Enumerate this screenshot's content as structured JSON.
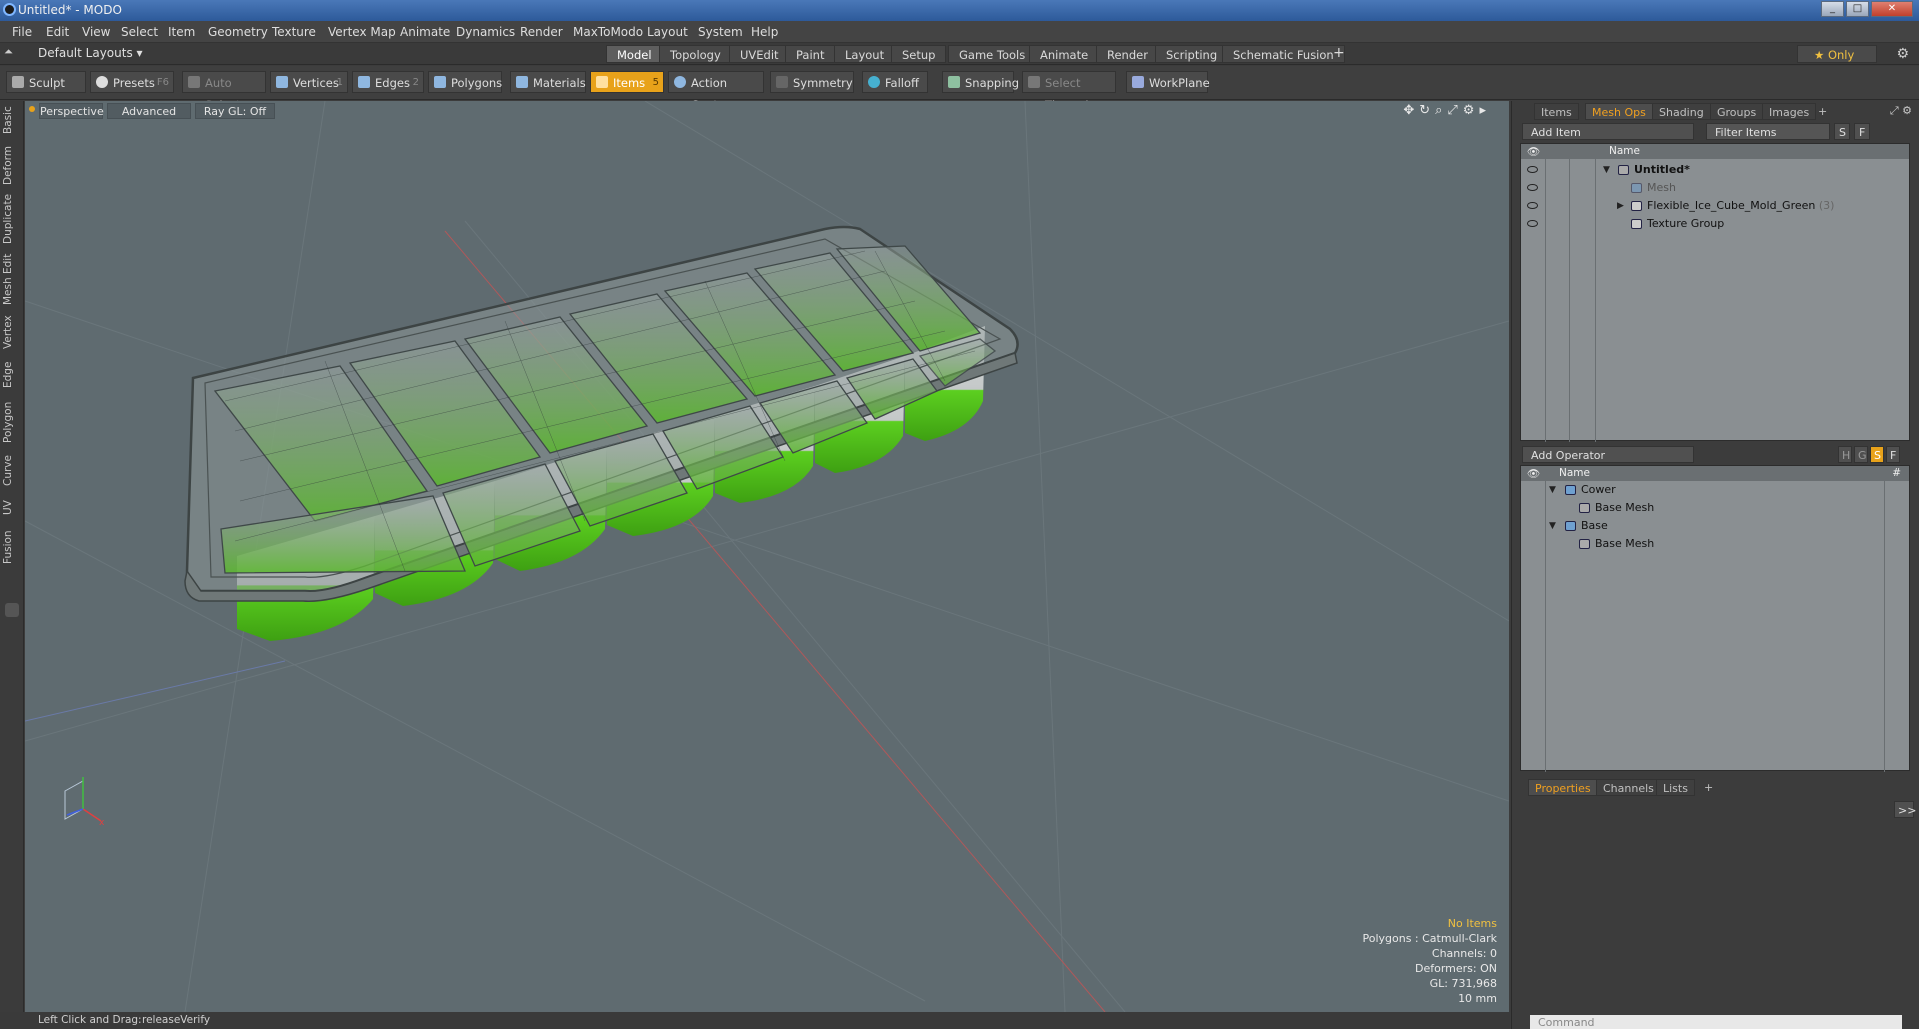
{
  "window": {
    "title": "Untitled* - MODO",
    "min": "_",
    "max": "□",
    "close": "✕"
  },
  "menu": [
    "File",
    "Edit",
    "View",
    "Select",
    "Item",
    "Geometry",
    "Texture",
    "Vertex Map",
    "Animate",
    "Dynamics",
    "Render",
    "MaxToModo",
    "Layout",
    "System",
    "Help"
  ],
  "layouts": {
    "current": "Default Layouts ▾",
    "tabs": [
      "Model",
      "Topology",
      "UVEdit",
      "Paint",
      "Layout",
      "Setup",
      "Game Tools",
      "Animate",
      "Render",
      "Scripting",
      "Schematic Fusion"
    ],
    "add": "+",
    "only": "★ Only",
    "active_tab": "Model"
  },
  "toolbar": {
    "sculpt": "Sculpt",
    "presets": "Presets",
    "presets_key": "F6",
    "auto_select": "Auto Select",
    "vertices": "Vertices",
    "vertices_key": "1",
    "edges": "Edges",
    "edges_key": "2",
    "polygons": "Polygons",
    "materials": "Materials",
    "items": "Items",
    "items_key": "5",
    "action_center": "Action Center",
    "symmetry": "Symmetry",
    "falloff": "Falloff",
    "snapping": "Snapping",
    "select_through": "Select Through",
    "workplane": "WorkPlane"
  },
  "side_tabs": [
    "Basic",
    "Deform",
    "Duplicate",
    "Mesh Edit",
    "Vertex",
    "Edge",
    "Polygon",
    "Curve",
    "UV",
    "Fusion"
  ],
  "viewport": {
    "view": "Perspective",
    "shading": "Advanced",
    "raygl": "Ray GL: Off",
    "stats": {
      "selection": "No Items",
      "polygons": "Polygons : Catmull-Clark",
      "channels": "Channels: 0",
      "deformers": "Deformers: ON",
      "gl": "GL: 731,968",
      "grid": "10 mm"
    }
  },
  "status": {
    "hint": "Left Click and Drag:",
    "action": "releaseVerify"
  },
  "items_panel": {
    "tabs": [
      "Items",
      "Mesh Ops",
      "Shading",
      "Groups",
      "Images",
      "+"
    ],
    "active": "Mesh Ops",
    "add_item": "Add Item",
    "filter": "Filter Items",
    "s": "S",
    "f": "F",
    "col_name": "Name",
    "rows": [
      {
        "label": "Untitled*",
        "count": ""
      },
      {
        "label": "Mesh",
        "count": ""
      },
      {
        "label": "Flexible_Ice_Cube_Mold_Green",
        "count": "(3)"
      },
      {
        "label": "Texture Group",
        "count": ""
      }
    ]
  },
  "meshops_panel": {
    "add_operator": "Add Operator",
    "h": "H",
    "g": "G",
    "s": "S",
    "f": "F",
    "col_name": "Name",
    "col_num": "#",
    "rows": [
      {
        "label": "Cower"
      },
      {
        "label": "Base Mesh"
      },
      {
        "label": "Base"
      },
      {
        "label": "Base Mesh"
      }
    ]
  },
  "props_panel": {
    "tabs": [
      "Properties",
      "Channels",
      "Lists",
      "+"
    ],
    "active": "Properties",
    "expand": ">>",
    "command": "Command"
  },
  "colors": {
    "accent": "#e8a21a",
    "viewport_bg": "#5f6b70",
    "mold_green": "#4cc21a"
  }
}
